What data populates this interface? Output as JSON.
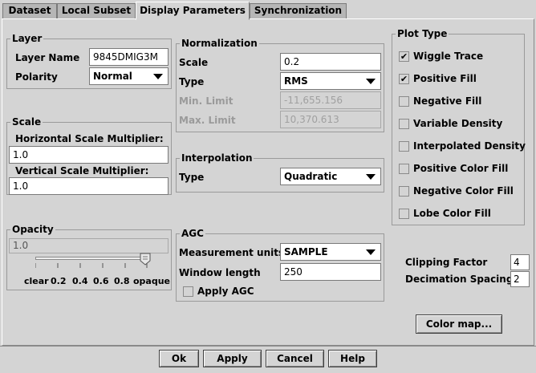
{
  "tabs": [
    {
      "label": "Dataset"
    },
    {
      "label": "Local Subset"
    },
    {
      "label": "Display Parameters"
    },
    {
      "label": "Synchronization"
    }
  ],
  "layer": {
    "title": "Layer",
    "name_label": "Layer Name",
    "name_value": "9845DMIG3M",
    "polarity_label": "Polarity",
    "polarity_value": "Normal"
  },
  "scale": {
    "title": "Scale",
    "h_label": "Horizontal Scale Multiplier:",
    "h_value": "1.0",
    "v_label": "Vertical Scale Multiplier:",
    "v_value": "1.0"
  },
  "opacity": {
    "title": "Opacity",
    "value": "1.0",
    "level": 0.98,
    "ticks": [
      "clear",
      "0.2",
      "0.4",
      "0.6",
      "0.8",
      "opaque"
    ]
  },
  "normalization": {
    "title": "Normalization",
    "scale_label": "Scale",
    "scale_value": "0.2",
    "type_label": "Type",
    "type_value": "RMS",
    "min_label": "Min. Limit",
    "min_value": "-11,655.156",
    "max_label": "Max. Limit",
    "max_value": "10,370.613"
  },
  "interpolation": {
    "title": "Interpolation",
    "type_label": "Type",
    "type_value": "Quadratic"
  },
  "agc": {
    "title": "AGC",
    "units_label": "Measurement units",
    "units_value": "SAMPLE",
    "window_label": "Window length",
    "window_value": "250",
    "apply_label": "Apply AGC",
    "apply_checked": false
  },
  "plot_type": {
    "title": "Plot Type",
    "items": [
      {
        "label": "Wiggle Trace",
        "checked": true
      },
      {
        "label": "Positive Fill",
        "checked": true
      },
      {
        "label": "Negative Fill",
        "checked": false
      },
      {
        "label": "Variable Density",
        "checked": false
      },
      {
        "label": "Interpolated Density",
        "checked": false
      },
      {
        "label": "Positive Color Fill",
        "checked": false
      },
      {
        "label": "Negative Color Fill",
        "checked": false
      },
      {
        "label": "Lobe Color Fill",
        "checked": false
      }
    ]
  },
  "clipping": {
    "label": "Clipping Factor",
    "value": "4"
  },
  "decimation": {
    "label": "Decimation Spacing",
    "value": "2"
  },
  "colormap_button": "Color map...",
  "buttons": {
    "ok": "Ok",
    "apply": "Apply",
    "cancel": "Cancel",
    "help": "Help"
  },
  "check_glyph": "✔"
}
